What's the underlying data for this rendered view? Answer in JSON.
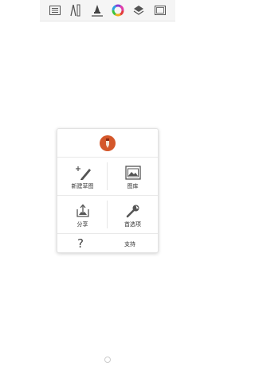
{
  "toolbar": {
    "items": [
      "list-icon",
      "ruler-compass-icon",
      "brush-icon",
      "color-wheel-icon",
      "layers-icon",
      "canvas-icon"
    ]
  },
  "menu": {
    "logo_icon": "pencil-logo-icon",
    "items": [
      {
        "label": "新建草图",
        "icon": "new-sketch-icon"
      },
      {
        "label": "图库",
        "icon": "gallery-icon"
      },
      {
        "label": "分享",
        "icon": "share-icon"
      },
      {
        "label": "首选项",
        "icon": "preferences-wrench-icon"
      }
    ],
    "help_symbol": "?",
    "support_label": "支持"
  },
  "colors": {
    "logo": "#d4572a",
    "icon": "#555555",
    "text": "#333333"
  }
}
